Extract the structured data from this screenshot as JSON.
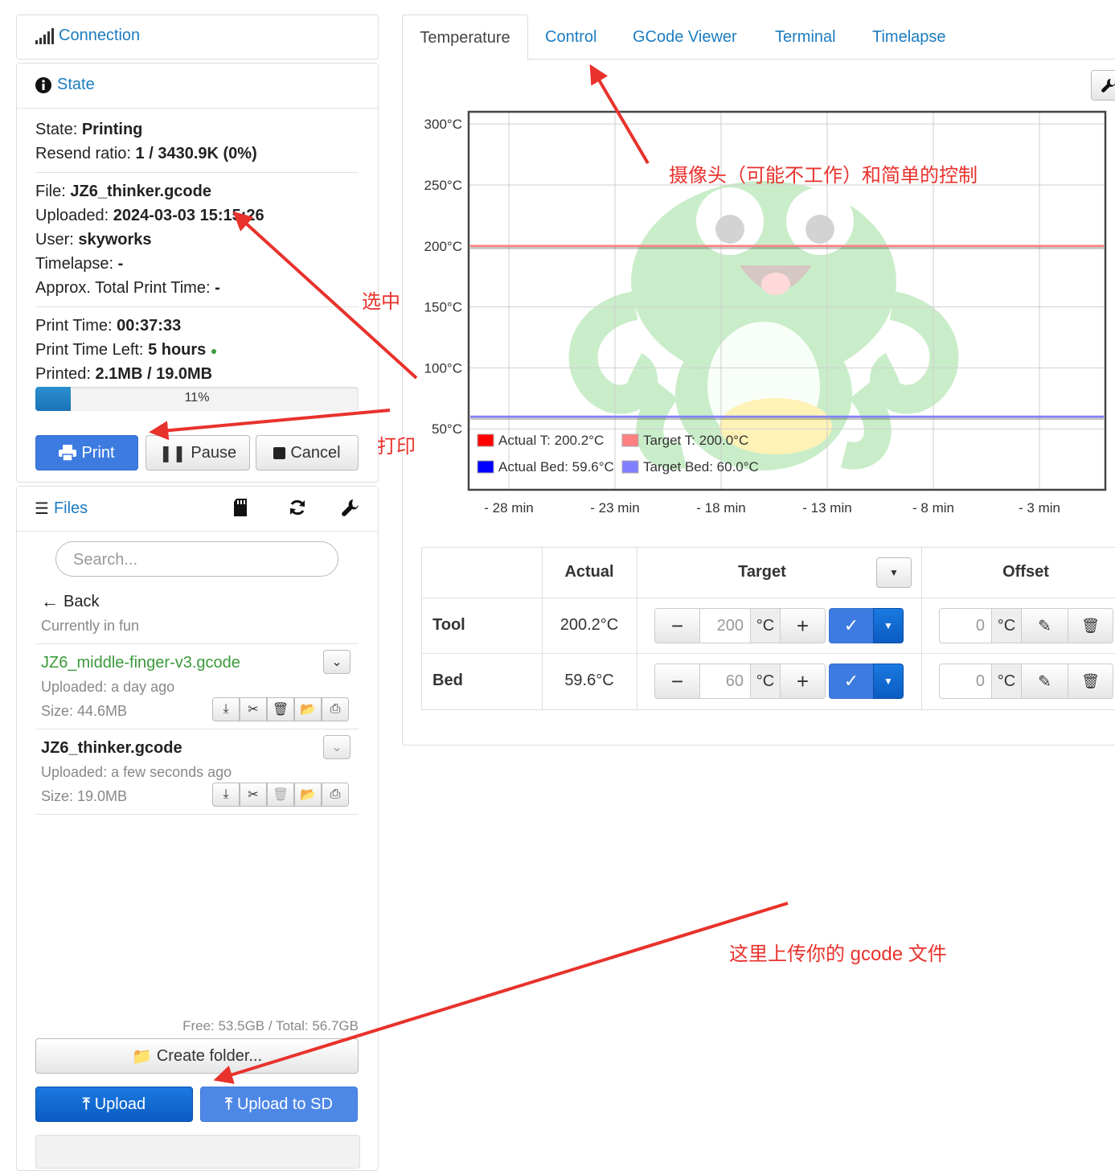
{
  "sidebar": {
    "connection": {
      "title": "Connection",
      "icon": "signal-icon"
    },
    "state": {
      "title": "State",
      "state_label": "State:",
      "state_value": "Printing",
      "resend_label": "Resend ratio:",
      "resend_value": "1 / 3430.9K (0%)",
      "file_label": "File:",
      "file_value": "JZ6_thinker.gcode",
      "uploaded_label": "Uploaded:",
      "uploaded_value": "2024-03-03 15:15:26",
      "user_label": "User:",
      "user_value": "skyworks",
      "timelapse_label": "Timelapse:",
      "timelapse_value": "-",
      "approx_label": "Approx. Total Print Time:",
      "approx_value": "-",
      "printtime_label": "Print Time:",
      "printtime_value": "00:37:33",
      "timeleft_label": "Print Time Left:",
      "timeleft_value": "5 hours",
      "printed_label": "Printed:",
      "printed_value": "2.1MB / 19.0MB",
      "progress_text": "11%",
      "progress_fraction": 0.11,
      "buttons": {
        "print": "Print",
        "pause": "Pause",
        "cancel": "Cancel"
      }
    },
    "files": {
      "title": "Files",
      "search_placeholder": "Search...",
      "back": "Back",
      "current_folder": "Currently in fun",
      "items": [
        {
          "name": "JZ6_middle-finger-v3.gcode",
          "uploaded": "Uploaded: a day ago",
          "size": "Size: 44.6MB"
        },
        {
          "name": "JZ6_thinker.gcode",
          "uploaded": "Uploaded: a few seconds ago",
          "size": "Size: 19.0MB"
        }
      ],
      "free_total": "Free: 53.5GB / Total: 56.7GB",
      "create_folder": "Create folder...",
      "upload": "Upload",
      "upload_sd": "Upload to SD"
    }
  },
  "tabs": [
    "Temperature",
    "Control",
    "GCode Viewer",
    "Terminal",
    "Timelapse"
  ],
  "chart_data": {
    "type": "line",
    "y_ticks": [
      "300°C",
      "250°C",
      "200°C",
      "150°C",
      "100°C",
      "50°C"
    ],
    "x_ticks": [
      "- 28 min",
      "- 23 min",
      "- 18 min",
      "- 13 min",
      "- 8 min",
      "- 3 min"
    ],
    "ylim": [
      0,
      310
    ],
    "series": [
      {
        "name": "Actual T: 200.2°C",
        "color": "#ff0000",
        "values": [
          200,
          200,
          200,
          200,
          200,
          200
        ]
      },
      {
        "name": "Target T: 200.0°C",
        "color": "#ff8080",
        "values": [
          200,
          200,
          200,
          200,
          200,
          200
        ]
      },
      {
        "name": "Actual Bed: 59.6°C",
        "color": "#0000ff",
        "values": [
          60,
          60,
          60,
          60,
          60,
          60
        ]
      },
      {
        "name": "Target Bed: 60.0°C",
        "color": "#8080ff",
        "values": [
          60,
          60,
          60,
          60,
          60,
          60
        ]
      }
    ]
  },
  "temp_table": {
    "headers": {
      "actual": "Actual",
      "target": "Target",
      "offset": "Offset"
    },
    "rows": [
      {
        "name": "Tool",
        "actual": "200.2°C",
        "target": "200",
        "unit": "°C",
        "offset": "0"
      },
      {
        "name": "Bed",
        "actual": "59.6°C",
        "target": "60",
        "unit": "°C",
        "offset": "0"
      }
    ]
  },
  "annotations": {
    "camera": "摄像头（可能不工作）和简单的控制",
    "select": "选中",
    "print": "打印",
    "upload": "这里上传你的 gcode 文件"
  }
}
